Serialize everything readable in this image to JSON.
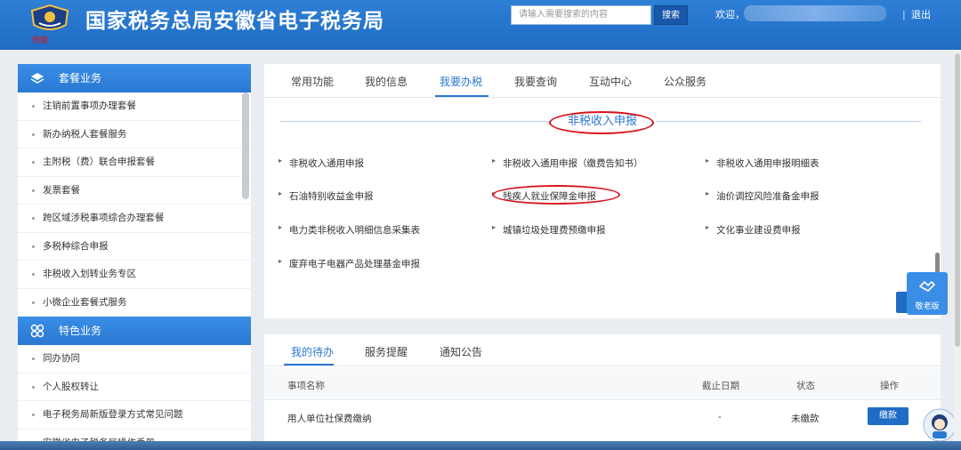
{
  "header": {
    "title": "国家税务总局安徽省电子税务局",
    "search_placeholder": "请输入需要搜索的内容",
    "search_button": "搜索",
    "welcome": "欢迎，",
    "divider": "|",
    "logout": "退出"
  },
  "sidebar": {
    "group1": {
      "label": "套餐业务",
      "icon": "layers-icon"
    },
    "items1": [
      "注销前置事项办理套餐",
      "新办纳税人套餐服务",
      "主附税（费）联合申报套餐",
      "发票套餐",
      "跨区域涉税事项综合办理套餐",
      "多税种综合申报",
      "非税收入划转业务专区",
      "小微企业套餐式服务"
    ],
    "group2": {
      "label": "特色业务",
      "icon": "grid-icon"
    },
    "items2": [
      "同办协同",
      "个人股权转让",
      "电子税务局新版登录方式常见问题",
      "安徽省电子税务局操作手册"
    ]
  },
  "main": {
    "tabs": [
      "常用功能",
      "我的信息",
      "我要办税",
      "我要查询",
      "互动中心",
      "公众服务"
    ],
    "active_tab": "我要办税",
    "section_title": "非税收入申报",
    "links": [
      "非税收入通用申报",
      "非税收入通用申报（缴费告知书）",
      "非税收入通用申报明细表",
      "石油特别收益金申报",
      "残疾人就业保障金申报",
      "油价调控风险准备金申报",
      "电力类非税收入明细信息采集表",
      "城镇垃圾处理费预缴申报",
      "文化事业建设费申报",
      "废弃电子电器产品处理基金申报"
    ],
    "side_float": {
      "label": "敬老版",
      "icon": "handshake-icon"
    }
  },
  "todo": {
    "tabs": [
      "我的待办",
      "服务提醒",
      "通知公告"
    ],
    "columns": [
      "事项名称",
      "截止日期",
      "状态",
      "操作"
    ],
    "rows": [
      {
        "name": "用人单位社保费缴纳",
        "deadline": "-",
        "status": "未缴款",
        "action": "缴款"
      }
    ]
  },
  "colors": {
    "header_blue": "#1f6cc4",
    "accent_blue": "#2a78d2",
    "highlight_red": "#d8141c"
  }
}
